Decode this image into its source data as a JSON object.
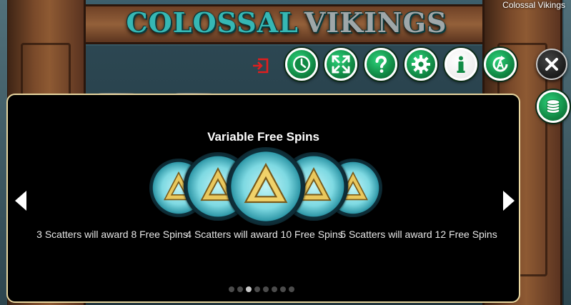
{
  "app": {
    "title": "Colossal Vikings"
  },
  "logo": {
    "part1": "COLOSSAL",
    "part2": "VIKINGS"
  },
  "toolbar": {
    "buttons": [
      {
        "name": "exit",
        "icon": "exit-icon"
      },
      {
        "name": "history",
        "icon": "clock-icon"
      },
      {
        "name": "fullscreen",
        "icon": "fullscreen-icon"
      },
      {
        "name": "help",
        "icon": "question-icon"
      },
      {
        "name": "settings",
        "icon": "gear-icon"
      },
      {
        "name": "info",
        "icon": "info-icon"
      },
      {
        "name": "autoplay",
        "icon": "autoplay-icon"
      },
      {
        "name": "close",
        "icon": "close-icon"
      },
      {
        "name": "bet",
        "icon": "coins-icon"
      }
    ],
    "accent_color": "#118a45"
  },
  "panel": {
    "title": "Variable Free Spins",
    "descriptions": [
      "3 Scatters will award 8 Free Spins",
      "4 Scatters will award 10 Free Spins",
      "5 Scatters will award 12 Free Spins"
    ],
    "page_count": 8,
    "current_page": 3,
    "border_color": "#e8d7a0"
  }
}
